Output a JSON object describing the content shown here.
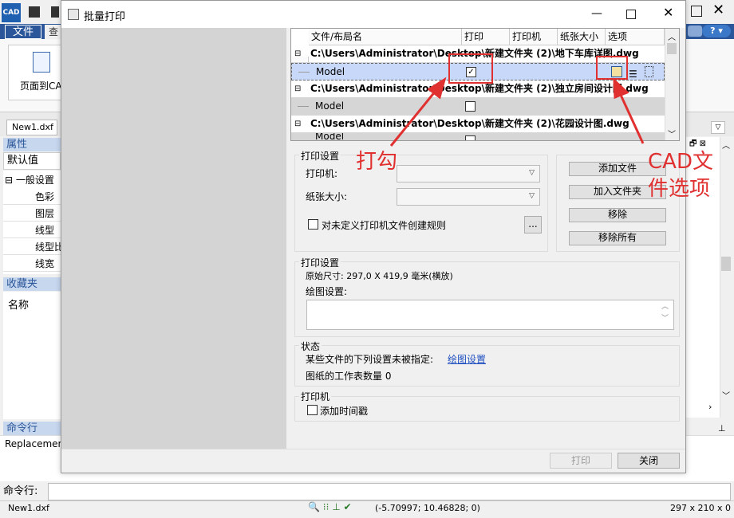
{
  "app": {
    "logo": "CAD",
    "tab_file": "文件",
    "tab_partial": "查",
    "ribbon_btn": "页面到CA",
    "doc_tab": "New1.dxf",
    "properties_title": "属性",
    "default_label": "默认值",
    "general_settings": "一般设置",
    "props": [
      "色彩",
      "图层",
      "线型",
      "线型比",
      "线宽"
    ],
    "favorites": "收藏夹",
    "name_label": "名称",
    "cmdline_title": "命令行",
    "cmd_output": "Replacement",
    "cmd_prompt": "命令行:",
    "status_file": "New1.dxf",
    "status_coords": "(-5.70997; 10.46828; 0)",
    "status_paper": "297 x 210 x 0"
  },
  "dialog": {
    "title": "批量打印",
    "columns": [
      "文件/布局名",
      "打印",
      "打印机",
      "纸张大小",
      "选项"
    ],
    "rows": [
      {
        "type": "file",
        "text": "C:\\Users\\Administrator\\Desktop\\新建文件夹 (2)\\地下车库详图.dwg"
      },
      {
        "type": "layout",
        "text": "Model",
        "checked": true,
        "selected": true
      },
      {
        "type": "file",
        "text": "C:\\Users\\Administrator\\Desktop\\新建文件夹 (2)\\独立房间设计图.dwg"
      },
      {
        "type": "layout",
        "text": "Model",
        "checked": false
      },
      {
        "type": "file",
        "text": "C:\\Users\\Administrator\\Desktop\\新建文件夹 (2)\\花园设计图.dwg"
      },
      {
        "type": "layout",
        "text": "Model",
        "checked": false
      }
    ],
    "print_settings_title": "打印设置",
    "printer_label": "打印机:",
    "paper_label": "纸张大小:",
    "rule_checkbox": "对未定义打印机文件创建规则",
    "more_btn": "...",
    "add_file": "添加文件",
    "add_folder": "加入文件夹",
    "remove": "移除",
    "remove_all": "移除所有",
    "info_title": "打印设置",
    "original_size": "原始尺寸: 297,0 X 419,9 毫米(横放)",
    "plot_settings": "绘图设置:",
    "status_title": "状态",
    "status_text": "某些文件的下列设置未被指定:",
    "status_link": "绘图设置",
    "sheet_count": "图纸的工作表数量 0",
    "printer_title": "打印机",
    "timestamp": "添加时间戳",
    "print_btn": "打印",
    "close_btn": "关闭"
  },
  "annotations": {
    "check": "打勾",
    "options": "CAD文件选项"
  },
  "colors": {
    "annotation": "#e03030",
    "accent": "#2b579a",
    "selected_row": "#c8d8f8"
  }
}
